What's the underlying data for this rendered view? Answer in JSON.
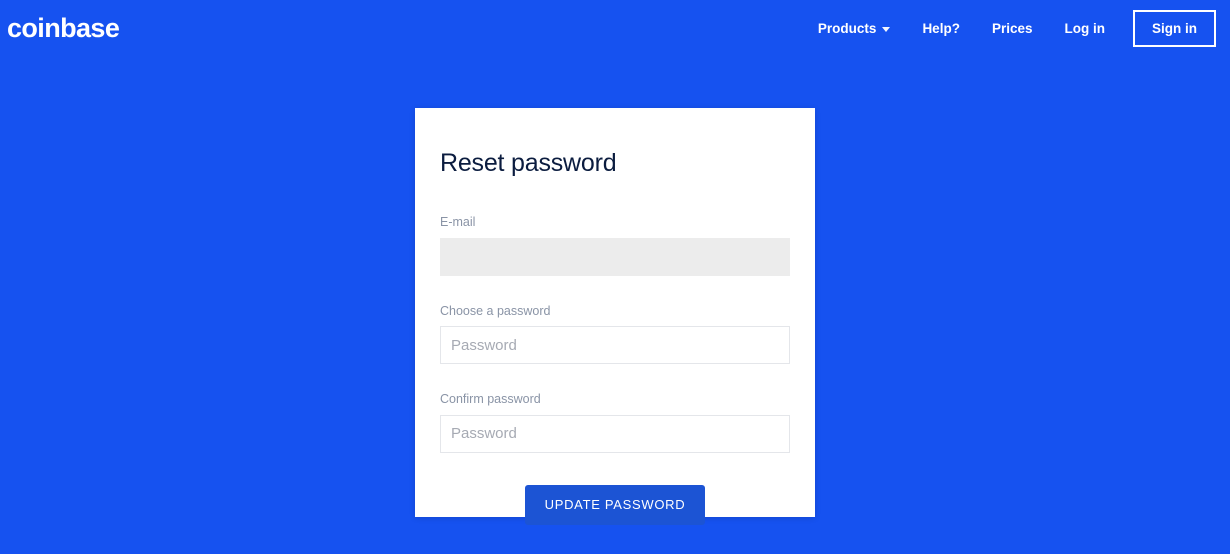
{
  "page": {
    "background_color": "#1652f0"
  },
  "header": {
    "logo_text": "coinbase",
    "nav": [
      {
        "label": "Products",
        "has_caret": true,
        "icon": "chevron-down-icon"
      },
      {
        "label": "Help?",
        "has_caret": false
      },
      {
        "label": "Prices",
        "has_caret": false
      },
      {
        "label": "Log in",
        "has_caret": false
      }
    ],
    "signin_label": "Sign in"
  },
  "card": {
    "title": "Reset password",
    "fields": [
      {
        "label": "E-mail",
        "value": "",
        "placeholder": "",
        "disabled": true
      },
      {
        "label": "Choose a password",
        "value": "",
        "placeholder": "Password",
        "disabled": false
      },
      {
        "label": "Confirm password",
        "value": "",
        "placeholder": "Password",
        "disabled": false
      }
    ],
    "submit_label": "UPDATE PASSWORD",
    "submit_color": "#1c54d4"
  }
}
